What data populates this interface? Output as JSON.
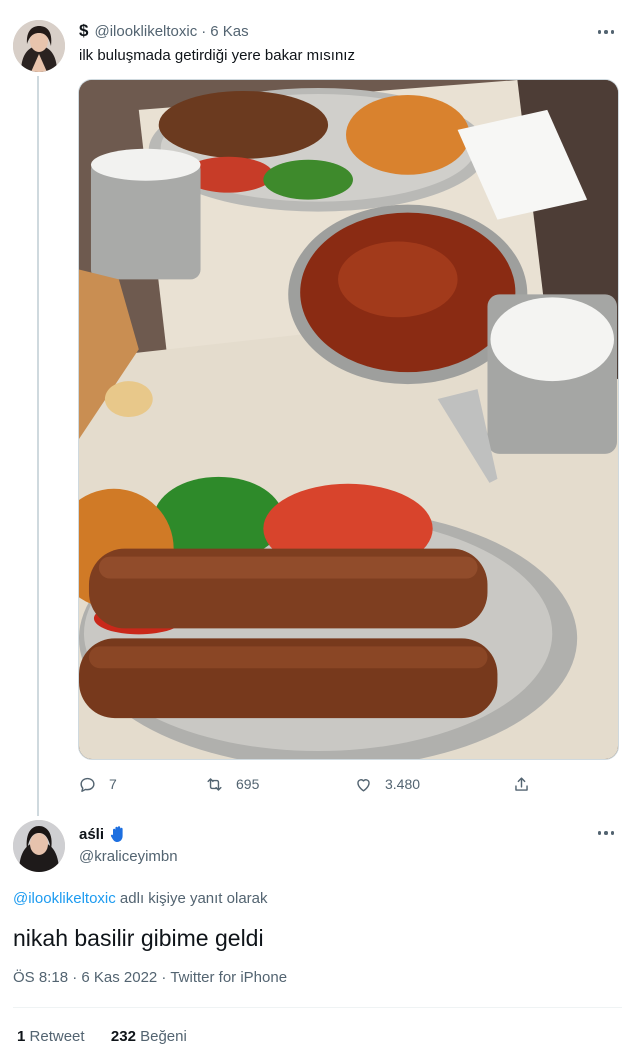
{
  "tweet": {
    "display_name": "$",
    "handle": "@ilooklikeltoxic",
    "separator": "·",
    "date": "6 Kas",
    "text": "ilk buluşmada getirdiği yere bakar mısınız",
    "image_alt": "Adana kebap, tomatoes, green onions, bulgur, ezme salad and ayran on a restaurant table",
    "actions": {
      "replies": "7",
      "retweets": "695",
      "likes": "3.480"
    }
  },
  "reply": {
    "display_name": "aśli",
    "handle": "@kraliceyimbn",
    "reply_handle": "@ilooklikeltoxic",
    "reply_suffix": " adlı kişiye yanıt olarak",
    "text": "nikah basilir gibime geldi",
    "meta": "ÖS 8:18 · 6 Kas 2022 · Twitter for iPhone",
    "stats": {
      "retweets_count": "1",
      "retweets_label": "Retweet",
      "likes_count": "232",
      "likes_label": "Beğeni"
    }
  },
  "colors": {
    "link": "#1d9bf0",
    "muted": "#536471",
    "text": "#0f1419",
    "divider": "#eff3f4"
  }
}
